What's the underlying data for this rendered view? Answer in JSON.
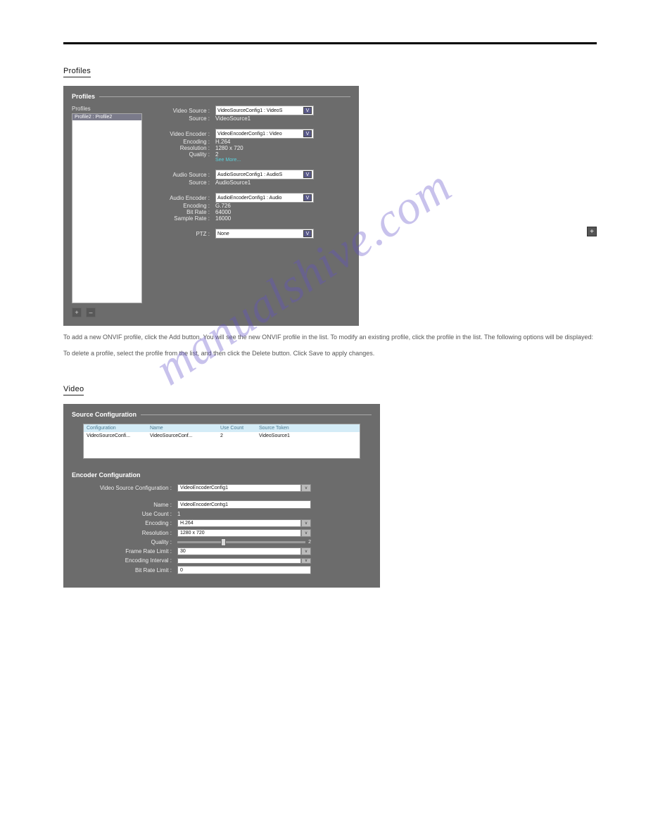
{
  "watermark": "manualshive.com",
  "plus_glyph": "+",
  "sections": {
    "profiles": {
      "title": "Profiles",
      "panel_heading": "Profiles",
      "list_label": "Profiles",
      "list_item": "Profile2 : Profile2",
      "add_glyph": "+",
      "remove_glyph": "–",
      "video_source": {
        "label": "Video Source :",
        "selected": "VideoSourceConfig1 : VideoS",
        "source_label": "Source :",
        "source_value": "VideoSource1"
      },
      "video_encoder": {
        "label": "Video Encoder :",
        "selected": "VideoEncoderConfig1 : Video",
        "encoding_label": "Encoding :",
        "encoding_value": "H.264",
        "resolution_label": "Resolution :",
        "resolution_value": "1280 x 720",
        "quality_label": "Quality :",
        "quality_value": "2",
        "see_more": "See More..."
      },
      "audio_source": {
        "label": "Audio Source :",
        "selected": "AudioSourceConfig1 : AudioS",
        "source_label": "Source :",
        "source_value": "AudioSource1"
      },
      "audio_encoder": {
        "label": "Audio Encoder :",
        "selected": "AudioEncoderConfig1 : Audio",
        "encoding_label": "Encoding :",
        "encoding_value": "G.726",
        "bitrate_label": "Bit Rate :",
        "bitrate_value": "64000",
        "samplerate_label": "Sample Rate :",
        "samplerate_value": "16000"
      },
      "ptz": {
        "label": "PTZ :",
        "selected": "None"
      },
      "blurb1": "To add a new ONVIF profile, click the Add button. You will see the new ONVIF profile in the list. To modify an existing profile, click the profile in the list. The following options will be displayed:",
      "blurb2": "To delete a profile, select the profile from the list, and then click the Delete button. Click Save to apply changes."
    },
    "video": {
      "title": "Video",
      "source_heading": "Source Configuration",
      "table": {
        "h1": "Configuration",
        "h2": "Name",
        "h3": "Use Count",
        "h4": "Source Token",
        "r1c1": "VideoSourceConfi...",
        "r1c2": "VideoSourceConf...",
        "r1c3": "2",
        "r1c4": "VideoSource1"
      },
      "encoder_heading": "Encoder Configuration",
      "fields": {
        "vec_label": "Video Source Configuration :",
        "vec_value": "VideoEncoderConfig1",
        "name_label": "Name :",
        "name_value": "VideoEncoderConfig1",
        "use_count_label": "Use Count :",
        "use_count_value": "1",
        "encoding_label": "Encoding :",
        "encoding_value": "H.264",
        "resolution_label": "Resolution :",
        "resolution_value": "1280 x 720",
        "quality_label": "Quality :",
        "quality_value": "2",
        "frame_rate_label": "Frame Rate Limit :",
        "frame_rate_value": "30",
        "enc_interval_label": "Encoding Interval :",
        "enc_interval_value": "",
        "bit_rate_label": "Bit Rate Limit :",
        "bit_rate_value": "0"
      }
    }
  }
}
